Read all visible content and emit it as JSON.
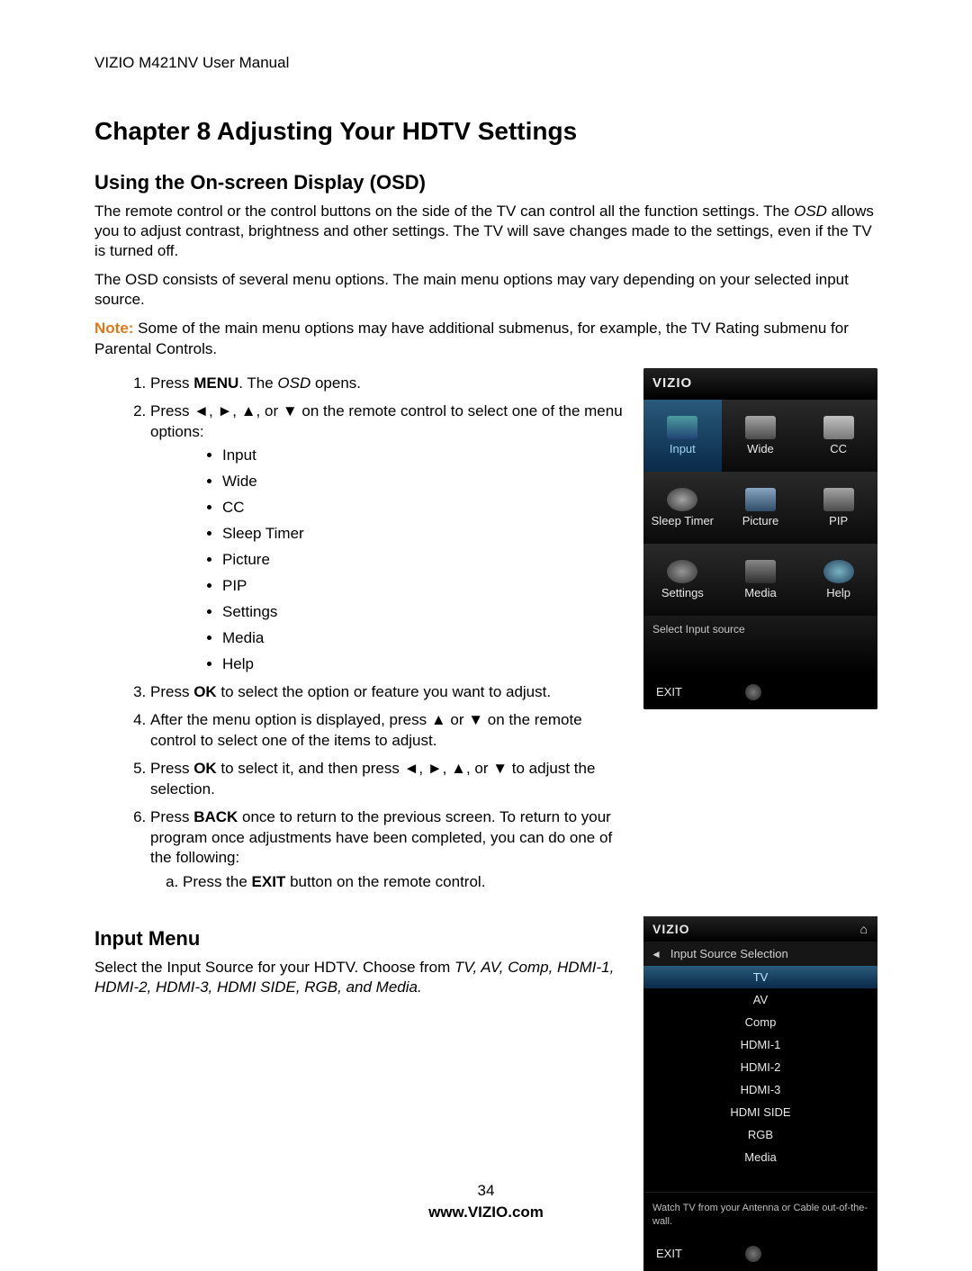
{
  "doc_header": "VIZIO M421NV User Manual",
  "chapter_title": "Chapter 8 Adjusting Your HDTV Settings",
  "sections": {
    "osd": {
      "heading": "Using the On-screen Display (OSD)",
      "p1_part1": "The remote control or the control buttons on the side of the TV can control all the function settings. The ",
      "p1_italic": "OSD",
      "p1_part2": " allows you to adjust contrast, brightness and other settings. The TV will save changes made to the settings, even if the TV is turned off.",
      "p2": "The OSD consists of several menu options. The main menu options may vary depending on your selected input source.",
      "note_label": "Note:",
      "note_text": "  Some of the main menu options may have additional submenus, for example, the TV Rating submenu for Parental Controls.",
      "steps": {
        "s1_a": "Press ",
        "s1_bold": "MENU",
        "s1_b": ". The ",
        "s1_italic": "OSD",
        "s1_c": " opens.",
        "s2": "Press ◄, ►, ▲, or ▼ on the remote control to select one of the menu options:",
        "bullets": [
          "Input",
          "Wide",
          "CC",
          "Sleep Timer",
          "Picture",
          "PIP",
          "Settings",
          "Media",
          "Help"
        ],
        "s3_a": "Press ",
        "s3_bold": "OK",
        "s3_b": " to select the option or feature you want to adjust.",
        "s4": "After the menu option is displayed, press ▲ or ▼ on the remote control to select one of the items to adjust.",
        "s5_a": "Press ",
        "s5_bold": "OK",
        "s5_b": " to select it, and then press ◄, ►, ▲, or ▼ to adjust the selection.",
        "s6_a": "Press ",
        "s6_bold": "BACK",
        "s6_b": " once to return to the previous screen. To return to your program once adjustments have been completed, you can do one of the following:",
        "s6_sub_a_a": "Press the ",
        "s6_sub_a_bold": "EXIT",
        "s6_sub_a_b": " button on the remote control."
      }
    },
    "input": {
      "heading": "Input Menu",
      "p_a": "Select the Input Source for your HDTV. Choose from ",
      "p_italic": "TV, AV, Comp, HDMI-1, HDMI-2, HDMI-3, HDMI SIDE, RGB, and Media."
    }
  },
  "osd_panel": {
    "brand": "VIZIO",
    "cells": [
      {
        "label": "Input",
        "selected": true
      },
      {
        "label": "Wide",
        "selected": false
      },
      {
        "label": "CC",
        "selected": false
      },
      {
        "label": "Sleep Timer",
        "selected": false
      },
      {
        "label": "Picture",
        "selected": false
      },
      {
        "label": "PIP",
        "selected": false
      },
      {
        "label": "Settings",
        "selected": false
      },
      {
        "label": "Media",
        "selected": false
      },
      {
        "label": "Help",
        "selected": false
      }
    ],
    "status": "Select Input source",
    "exit": "EXIT"
  },
  "isrc_panel": {
    "brand": "VIZIO",
    "title": "Input Source Selection",
    "items": [
      {
        "label": "TV",
        "selected": true
      },
      {
        "label": "AV",
        "selected": false
      },
      {
        "label": "Comp",
        "selected": false
      },
      {
        "label": "HDMI-1",
        "selected": false
      },
      {
        "label": "HDMI-2",
        "selected": false
      },
      {
        "label": "HDMI-3",
        "selected": false
      },
      {
        "label": "HDMI SIDE",
        "selected": false
      },
      {
        "label": "RGB",
        "selected": false
      },
      {
        "label": "Media",
        "selected": false
      }
    ],
    "desc": "Watch TV from your Antenna or Cable out-of-the-wall.",
    "exit": "EXIT"
  },
  "footer": {
    "page_num": "34",
    "url": "www.VIZIO.com"
  }
}
